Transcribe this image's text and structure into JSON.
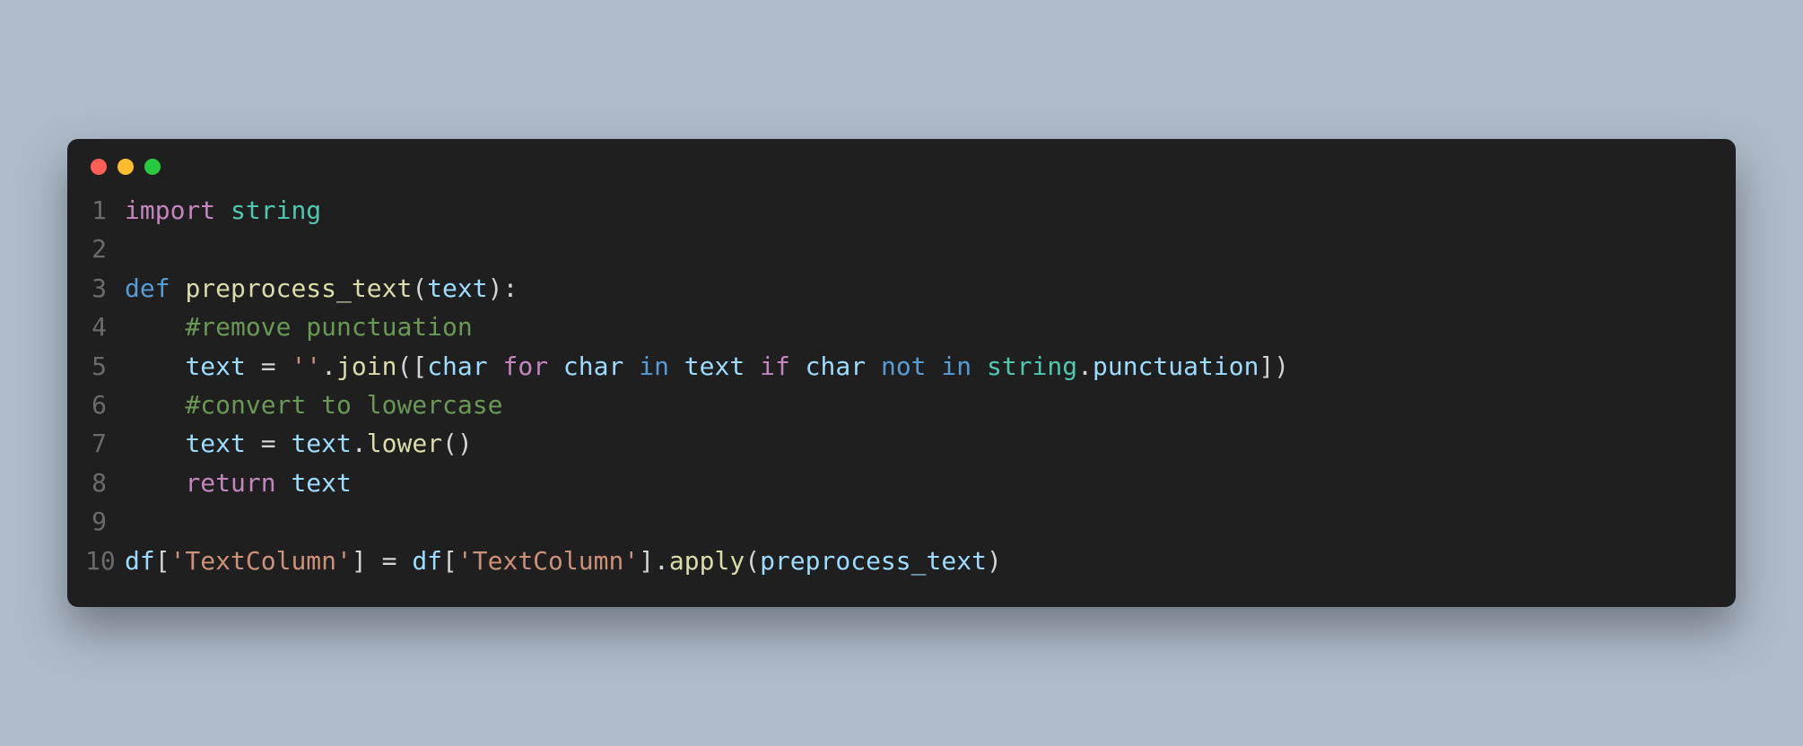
{
  "window": {
    "traffic_lights": {
      "red": "close",
      "yellow": "minimize",
      "green": "maximize"
    }
  },
  "code": {
    "line_numbers": [
      "1",
      "2",
      "3",
      "4",
      "5",
      "6",
      "7",
      "8",
      "9",
      "10"
    ],
    "lines": {
      "l1": {
        "import": "import",
        "sp1": " ",
        "string": "string"
      },
      "l2": {
        "blank": ""
      },
      "l3": {
        "def": "def",
        "sp1": " ",
        "fname": "preprocess_text",
        "lp": "(",
        "param": "text",
        "rp": ")",
        "colon": ":"
      },
      "l4": {
        "indent": "    ",
        "comment": "#remove punctuation"
      },
      "l5": {
        "indent": "    ",
        "text1": "text",
        "sp1": " ",
        "eq": "=",
        "sp2": " ",
        "str1": "''",
        "dot1": ".",
        "join": "join",
        "lp": "(",
        "lb": "[",
        "char1": "char",
        "sp3": " ",
        "for": "for",
        "sp4": " ",
        "char2": "char",
        "sp5": " ",
        "in1": "in",
        "sp6": " ",
        "text2": "text",
        "sp7": " ",
        "if": "if",
        "sp8": " ",
        "char3": "char",
        "sp9": " ",
        "not": "not",
        "sp10": " ",
        "in2": "in",
        "sp11": " ",
        "string": "string",
        "dot2": ".",
        "punct": "punctuation",
        "rb": "]",
        "rp": ")"
      },
      "l6": {
        "indent": "    ",
        "comment": "#convert to lowercase"
      },
      "l7": {
        "indent": "    ",
        "text1": "text",
        "sp1": " ",
        "eq": "=",
        "sp2": " ",
        "text2": "text",
        "dot": ".",
        "lower": "lower",
        "lp": "(",
        "rp": ")"
      },
      "l8": {
        "indent": "    ",
        "return": "return",
        "sp1": " ",
        "text": "text"
      },
      "l9": {
        "blank": ""
      },
      "l10": {
        "df1": "df",
        "lb1": "[",
        "str1": "'TextColumn'",
        "rb1": "]",
        "sp1": " ",
        "eq": "=",
        "sp2": " ",
        "df2": "df",
        "lb2": "[",
        "str2": "'TextColumn'",
        "rb2": "]",
        "dot": ".",
        "apply": "apply",
        "lp": "(",
        "arg": "preprocess_text",
        "rp": ")"
      }
    }
  }
}
